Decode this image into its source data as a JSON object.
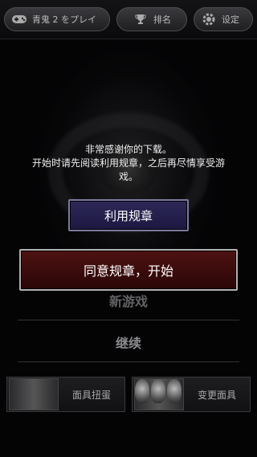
{
  "topbar": {
    "play_label": "青鬼 2 をプレイ",
    "rank_label": "排名",
    "settings_label": "设定"
  },
  "dialog": {
    "line1": "非常感谢你的下载。",
    "line2": "开始时请先阅读利用规章，之后再尽情享受游",
    "line3": "戏。"
  },
  "buttons": {
    "rules_label": "利用规章",
    "agree_label": "同意规章，开始"
  },
  "menu": {
    "new_game": "新游戏",
    "continue": "继续"
  },
  "bottom": {
    "gacha_label": "面具扭蛋",
    "change_label": "变更面具"
  },
  "colors": {
    "rules_button": "#2d2858",
    "agree_button": "#4e1212"
  },
  "icons": [
    "gamepad-icon",
    "trophy-icon",
    "gear-icon"
  ]
}
